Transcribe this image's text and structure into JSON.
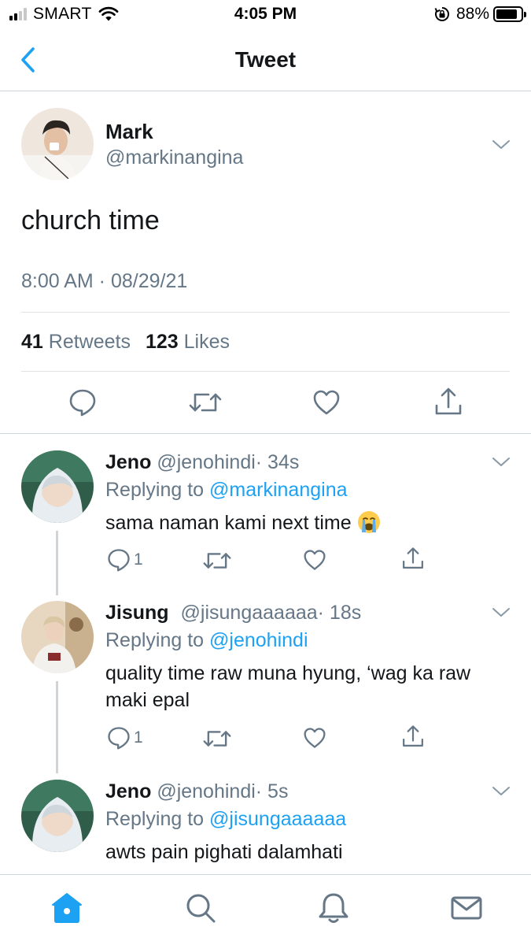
{
  "status_bar": {
    "carrier": "SMART",
    "time": "4:05 PM",
    "battery": "88%",
    "battery_level": 0.88,
    "signal_bars": 2,
    "icons": [
      "signal-icon",
      "wifi-icon",
      "rotation-lock-icon",
      "battery-icon"
    ]
  },
  "nav": {
    "title": "Tweet",
    "back_icon": "chevron-left-icon"
  },
  "tweet": {
    "name": "Mark",
    "handle": "@markinangina",
    "text": "church time",
    "timestamp": "8:00 AM · 08/29/21",
    "retweets_count": "41",
    "retweets_label": "Retweets",
    "likes_count": "123",
    "likes_label": "Likes",
    "actions": [
      "reply-icon",
      "retweet-icon",
      "like-icon",
      "share-icon"
    ]
  },
  "replies": [
    {
      "name": "Jeno",
      "handle": "@jenohindi",
      "time": "· 34s",
      "replying_prefix": "Replying to",
      "replying_to": "@markinangina",
      "text": "sama naman kami next time",
      "emoji": "crying-face",
      "reply_count": "1"
    },
    {
      "name": "Jisung",
      "handle": "@jisungaaaaaa",
      "time": "· 18s",
      "replying_prefix": "Replying to",
      "replying_to": "@jenohindi",
      "text_line1": "quality time raw muna hyung, ‘wag ka raw",
      "text_line2": "maki epal",
      "reply_count": "1"
    },
    {
      "name": "Jeno",
      "handle": "@jenohindi",
      "time": "· 5s",
      "replying_prefix": "Replying to",
      "replying_to": "@jisungaaaaaa",
      "text": "awts pain pighati dalamhati"
    }
  ],
  "tab_bar": {
    "active": "home",
    "tabs": [
      "home-icon",
      "search-icon",
      "notifications-icon",
      "messages-icon"
    ]
  },
  "colors": {
    "accent": "#1da1f2",
    "text_primary": "#14171a",
    "text_secondary": "#657786",
    "divider": "#cfd4d8"
  }
}
